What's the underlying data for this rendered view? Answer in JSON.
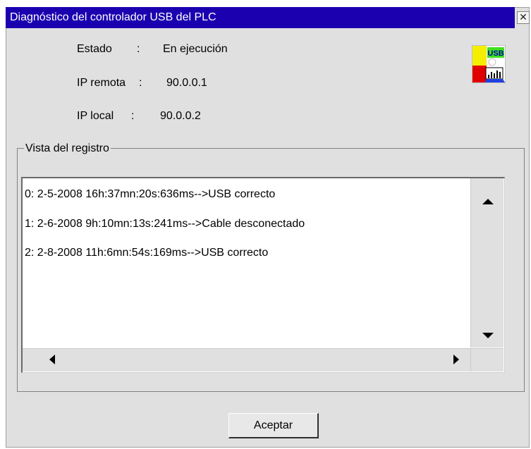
{
  "window": {
    "title": "Diagnóstico del controlador USB del PLC",
    "close_glyph": "✕"
  },
  "status": {
    "estado_label": "Estado",
    "estado_sep": ":",
    "estado_value": "En ejecución",
    "remote_label": "IP remota",
    "remote_sep": ":",
    "remote_value": "90.0.0.1",
    "local_label": "IP local",
    "local_sep": ":",
    "local_value": "90.0.0.2"
  },
  "icon": {
    "name": "usb-plc-icon",
    "badge_text": "USB"
  },
  "log": {
    "group_label": "Vista del registro",
    "entries": [
      "0: 2-5-2008  16h:37mn:20s:636ms-->USB correcto",
      "1: 2-6-2008  9h:10mn:13s:241ms-->Cable desconectado",
      "2: 2-8-2008  11h:6mn:54s:169ms-->USB correcto"
    ]
  },
  "buttons": {
    "ok_label": "Aceptar"
  },
  "colors": {
    "titlebar": "#1b00b0",
    "dialog_bg": "#e0e0e0"
  }
}
